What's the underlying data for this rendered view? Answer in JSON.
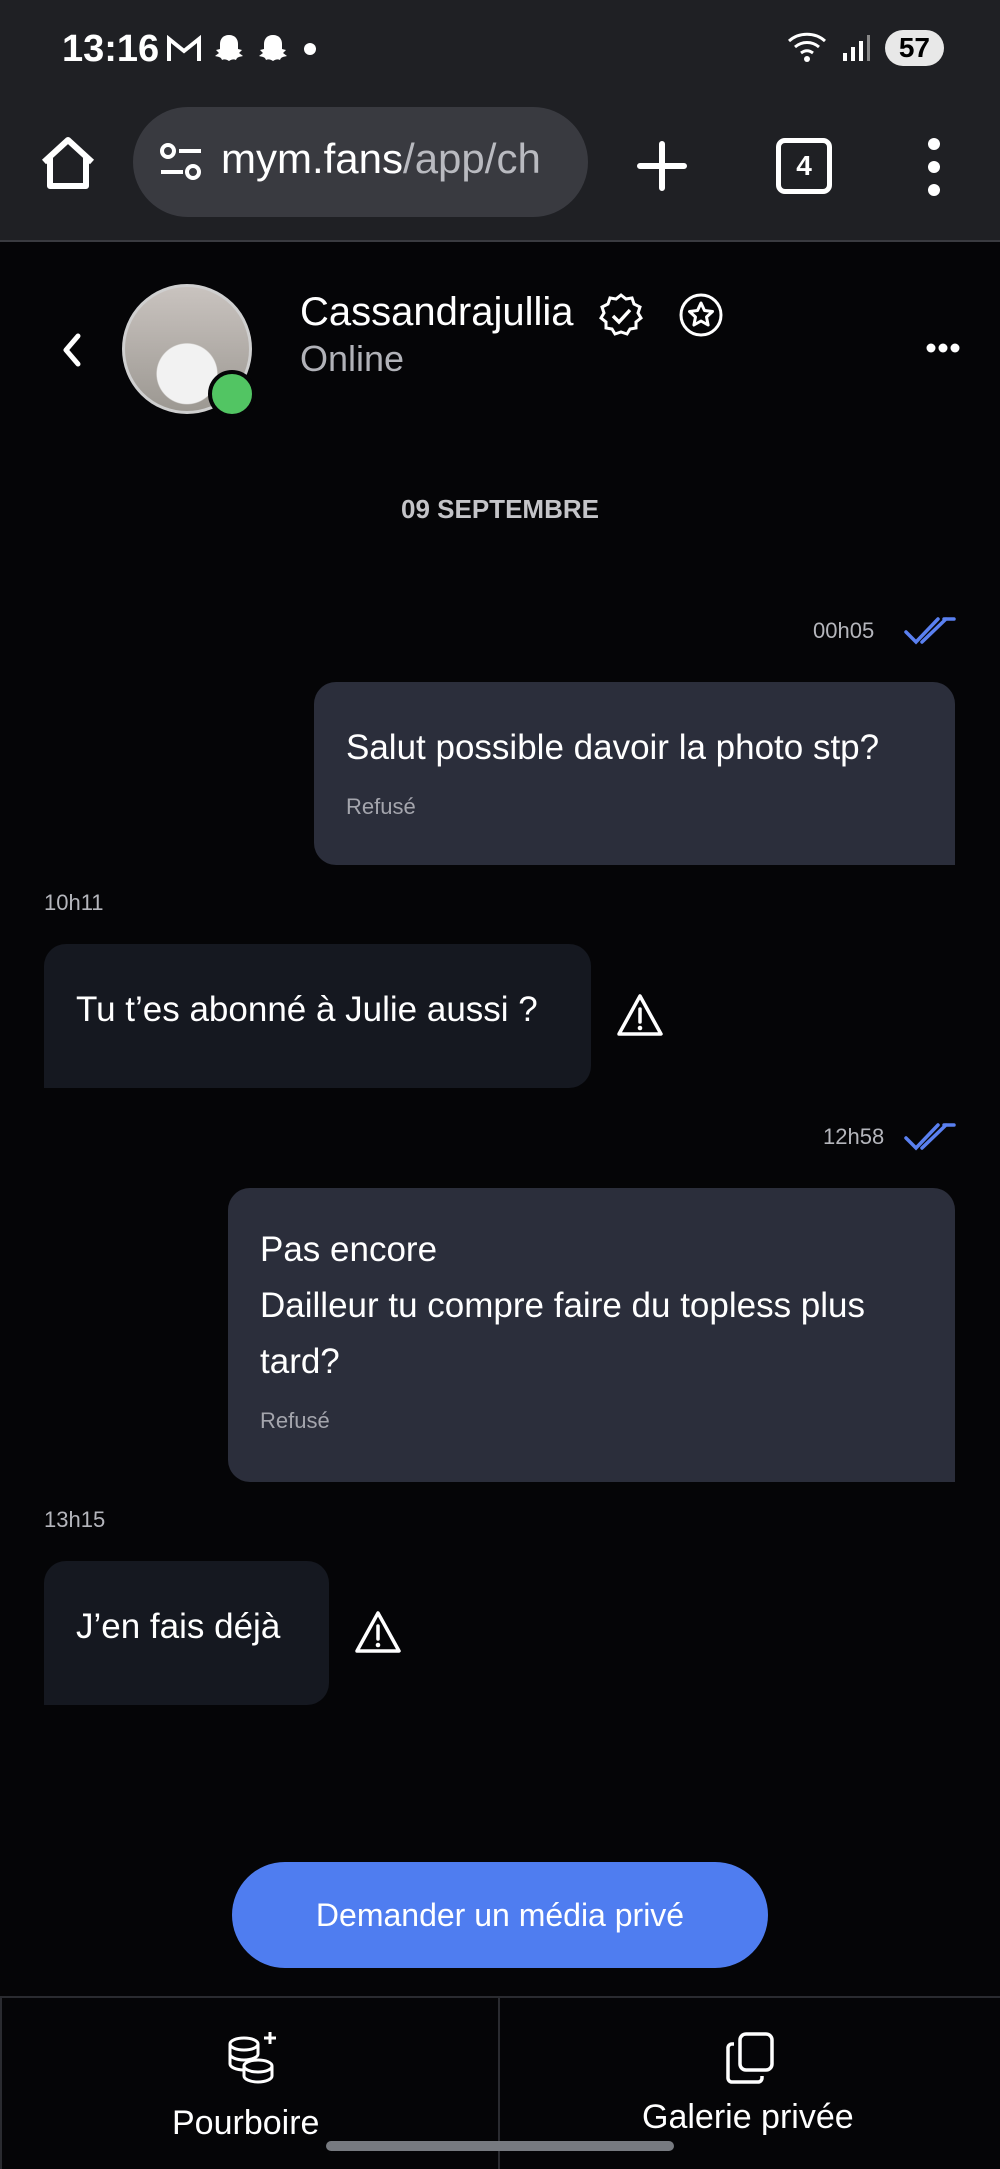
{
  "status_bar": {
    "time": "13:16",
    "battery": "57"
  },
  "browser": {
    "url_main": "mym.fans",
    "url_path": "/app/ch",
    "tab_count": "4"
  },
  "chat": {
    "contact_name": "Cassandrajullia",
    "presence": "Online",
    "date_separator": "09 SEPTEMBRE"
  },
  "messages": [
    {
      "direction": "out",
      "time": "00h05",
      "text": "Salut possible davoir la photo stp?",
      "status": "Refusé"
    },
    {
      "direction": "in",
      "time": "10h11",
      "text": "Tu t’es abonné à Julie aussi ?"
    },
    {
      "direction": "out",
      "time": "12h58",
      "text": "Pas encore\nDailleur tu compre faire du topless plus tard?",
      "status": "Refusé"
    },
    {
      "direction": "in",
      "time": "13h15",
      "text": "J’en fais déjà"
    }
  ],
  "actions": {
    "request_media": "Demander un média privé"
  },
  "bottom_tabs": {
    "tip": "Pourboire",
    "gallery": "Galerie privée"
  },
  "colors": {
    "accent": "#4f7df0",
    "online": "#52c563",
    "outgoing_bubble": "#2b2e3b",
    "incoming_bubble": "#151820",
    "read_check": "#5a80f0"
  }
}
